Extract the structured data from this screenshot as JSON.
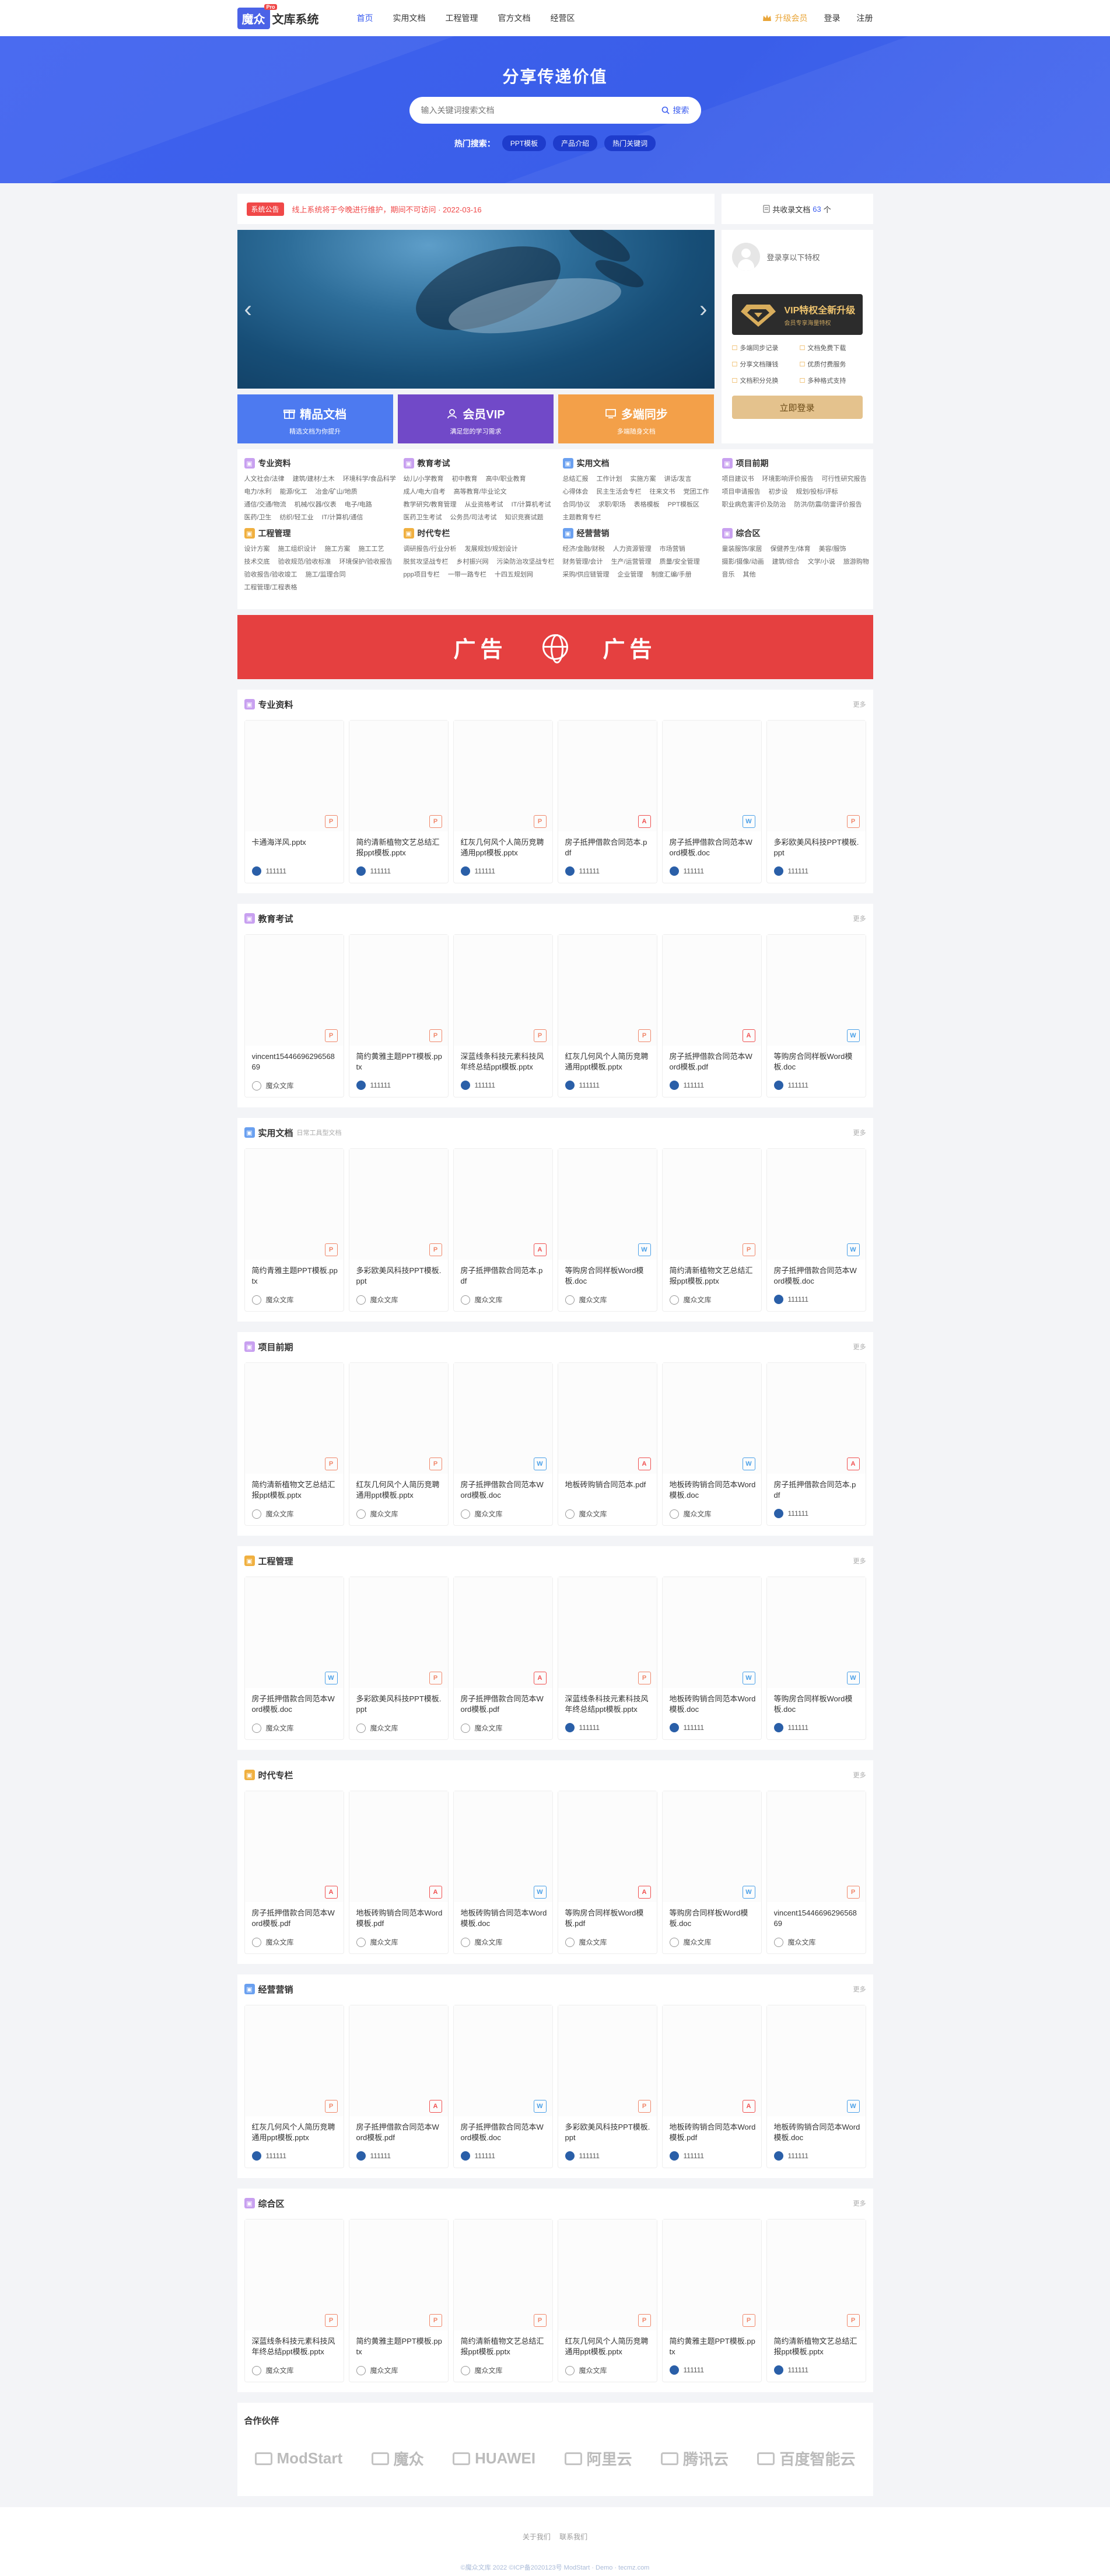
{
  "header": {
    "logo_box": "魔众",
    "logo_text": "文库系统",
    "logo_badge": "Pro",
    "nav": [
      "首页",
      "实用文档",
      "工程管理",
      "官方文档",
      "经营区"
    ],
    "vip": "升级会员",
    "login": "登录",
    "register": "注册"
  },
  "hero": {
    "title": "分享传递价值",
    "search_placeholder": "输入关键词搜索文档",
    "search_button": "搜索",
    "hot_label": "热门搜索：",
    "hot_tags": [
      "PPT模板",
      "产品介绍",
      "热门关键词"
    ]
  },
  "notice": {
    "tag": "系统公告",
    "text": "线上系统将于今晚进行维护，期间不可访问 · 2022-03-16"
  },
  "doccount": {
    "prefix": "共收录文档",
    "count": "63",
    "suffix": "个"
  },
  "banner": {
    "prev": "‹",
    "next": "›"
  },
  "features": [
    {
      "title": "精品文档",
      "sub": "精选文档为你提升"
    },
    {
      "title": "会员VIP",
      "sub": "满足您的学习需求"
    },
    {
      "title": "多端同步",
      "sub": "多端随身文档"
    }
  ],
  "user_panel": {
    "login_text": "登录享以下特权",
    "vip_title": "VIP特权全新升级",
    "vip_sub": "会员专享海量特权",
    "perks": [
      "多端同步记录",
      "文档免费下载",
      "分享文档赚钱",
      "优质付费服务",
      "文档积分兑换",
      "多种格式支持"
    ],
    "login_button": "立即登录"
  },
  "categories": [
    {
      "name": "专业资料",
      "color": "#c8a0f0",
      "items": [
        "人文社会/法律",
        "建筑/建材/土木",
        "环境科学/食品科学",
        "电力/水利",
        "能源/化工",
        "冶金/矿山/地质",
        "通信/交通/物流",
        "机械/仪器/仪表",
        "电子/电路",
        "医药/卫生",
        "纺织/轻工业",
        "IT/计算机/通信"
      ]
    },
    {
      "name": "教育考试",
      "color": "#c8a0f0",
      "items": [
        "幼儿/小学教育",
        "初中教育",
        "高中/职业教育",
        "成人/电大/自考",
        "高等教育/毕业论文",
        "教学研究/教育管理",
        "从业资格考试",
        "IT/计算机考试",
        "医药卫生考试",
        "公务员/司法考试",
        "知识竞赛试题"
      ]
    },
    {
      "name": "实用文档",
      "color": "#6aa0f0",
      "items": [
        "总结汇报",
        "工作计划",
        "实施方案",
        "讲话/发言",
        "心得体会",
        "民主生活会专栏",
        "往来文书",
        "党团工作",
        "合同/协议",
        "求职/职场",
        "表格模板",
        "PPT模板区",
        "主题教育专栏"
      ]
    },
    {
      "name": "项目前期",
      "color": "#c8a0f0",
      "items": [
        "项目建议书",
        "环境影响评价报告",
        "可行性研究报告",
        "项目申请报告",
        "初步设",
        "规划/投标/评标",
        "职业病危害评价及防治",
        "防洪/防震/防雷评价报告"
      ]
    },
    {
      "name": "工程管理",
      "color": "#f0b040",
      "items": [
        "设计方案",
        "施工组织设计",
        "施工方案",
        "施工工艺",
        "技术交底",
        "验收规范/验收标准",
        "环境保护/验收报告",
        "验收报告/验收竣工",
        "施工/监理合同",
        "工程管理/工程表格"
      ]
    },
    {
      "name": "时代专栏",
      "color": "#f0b040",
      "items": [
        "调研报告/行业分析",
        "发展规划/规划设计",
        "脱贫攻坚战专栏",
        "乡村振兴网",
        "污染防治攻坚战专栏",
        "ppp项目专栏",
        "一带一路专栏",
        "十四五规划网"
      ]
    },
    {
      "name": "经营营销",
      "color": "#6aa0f0",
      "items": [
        "经济/金融/财税",
        "人力资源管理",
        "市场营销",
        "财务管理/会计",
        "生产/运营管理",
        "质量/安全管理",
        "采购/供应链管理",
        "企业管理",
        "制度汇编/手册"
      ]
    },
    {
      "name": "综合区",
      "color": "#c8a0f0",
      "items": [
        "童装服饰/家居",
        "保健养生/体育",
        "美容/服饰",
        "摄影/摄像/动画",
        "建筑/综合",
        "文学/小说",
        "旅游购物",
        "音乐",
        "其他"
      ]
    }
  ],
  "ad": {
    "left": "广告",
    "right": "广告"
  },
  "sections": [
    {
      "title": "专业资料",
      "sub": "",
      "more": "更多",
      "color": "#c8a0f0",
      "cards": [
        {
          "name": "卡通海洋风.pptx",
          "type": "P",
          "author": "111111",
          "av": "blue"
        },
        {
          "name": "简约清新植物文艺总结汇报ppt模板.pptx",
          "type": "P",
          "author": "111111",
          "av": "blue"
        },
        {
          "name": "红灰几何风个人简历竞聘通用ppt模板.pptx",
          "type": "P",
          "author": "111111",
          "av": "blue"
        },
        {
          "name": "房子抵押借款合同范本.pdf",
          "type": "A",
          "author": "111111",
          "av": "blue"
        },
        {
          "name": "房子抵押借款合同范本Word模板.doc",
          "type": "W",
          "author": "111111",
          "av": "blue"
        },
        {
          "name": "多彩欧美风科技PPT模板.ppt",
          "type": "P",
          "author": "111111",
          "av": "blue"
        }
      ]
    },
    {
      "title": "教育考试",
      "sub": "",
      "more": "更多",
      "color": "#c8a0f0",
      "cards": [
        {
          "name": "vincent1544669629656869",
          "type": "P",
          "author": "魔众文库",
          "av": "gray"
        },
        {
          "name": "简约黄雅主题PPT模板.pptx",
          "type": "P",
          "author": "111111",
          "av": "blue"
        },
        {
          "name": "深蓝线条科技元素科技风年终总结ppt模板.pptx",
          "type": "P",
          "author": "111111",
          "av": "blue"
        },
        {
          "name": "红灰几何风个人简历竞聘通用ppt模板.pptx",
          "type": "P",
          "author": "111111",
          "av": "blue"
        },
        {
          "name": "房子抵押借款合同范本Word模板.pdf",
          "type": "A",
          "author": "111111",
          "av": "blue"
        },
        {
          "name": "等购房合同样板Word模板.doc",
          "type": "W",
          "author": "111111",
          "av": "blue"
        }
      ]
    },
    {
      "title": "实用文档",
      "sub": "日常工具型文档",
      "more": "更多",
      "color": "#6aa0f0",
      "cards": [
        {
          "name": "简约青雅主题PPT模板.pptx",
          "type": "P",
          "author": "魔众文库",
          "av": "gray"
        },
        {
          "name": "多彩欧美风科技PPT模板.ppt",
          "type": "P",
          "author": "魔众文库",
          "av": "gray"
        },
        {
          "name": "房子抵押借款合同范本.pdf",
          "type": "A",
          "author": "魔众文库",
          "av": "gray"
        },
        {
          "name": "等购房合同样板Word模板.doc",
          "type": "W",
          "author": "魔众文库",
          "av": "gray"
        },
        {
          "name": "简约清新植物文艺总结汇报ppt模板.pptx",
          "type": "P",
          "author": "魔众文库",
          "av": "gray"
        },
        {
          "name": "房子抵押借款合同范本Word模板.doc",
          "type": "W",
          "author": "111111",
          "av": "blue"
        }
      ]
    },
    {
      "title": "项目前期",
      "sub": "",
      "more": "更多",
      "color": "#c8a0f0",
      "cards": [
        {
          "name": "简约清新植物文艺总结汇报ppt模板.pptx",
          "type": "P",
          "author": "魔众文库",
          "av": "gray"
        },
        {
          "name": "红灰几何风个人简历竞聘通用ppt模板.pptx",
          "type": "P",
          "author": "魔众文库",
          "av": "gray"
        },
        {
          "name": "房子抵押借款合同范本Word模板.doc",
          "type": "W",
          "author": "魔众文库",
          "av": "gray"
        },
        {
          "name": "地板砖购销合同范本.pdf",
          "type": "A",
          "author": "魔众文库",
          "av": "gray"
        },
        {
          "name": "地板砖购销合同范本Word模板.doc",
          "type": "W",
          "author": "魔众文库",
          "av": "gray"
        },
        {
          "name": "房子抵押借款合同范本.pdf",
          "type": "A",
          "author": "111111",
          "av": "blue"
        }
      ]
    },
    {
      "title": "工程管理",
      "sub": "",
      "more": "更多",
      "color": "#f0b040",
      "cards": [
        {
          "name": "房子抵押借款合同范本Word模板.doc",
          "type": "W",
          "author": "魔众文库",
          "av": "gray"
        },
        {
          "name": "多彩欧美风科技PPT模板.ppt",
          "type": "P",
          "author": "魔众文库",
          "av": "gray"
        },
        {
          "name": "房子抵押借款合同范本Word模板.pdf",
          "type": "A",
          "author": "魔众文库",
          "av": "gray"
        },
        {
          "name": "深蓝线条科技元素科技风年终总结ppt模板.pptx",
          "type": "P",
          "author": "111111",
          "av": "blue"
        },
        {
          "name": "地板砖购销合同范本Word模板.doc",
          "type": "W",
          "author": "111111",
          "av": "blue"
        },
        {
          "name": "等购房合同样板Word模板.doc",
          "type": "W",
          "author": "111111",
          "av": "blue"
        }
      ]
    },
    {
      "title": "时代专栏",
      "sub": "",
      "more": "更多",
      "color": "#f0b040",
      "cards": [
        {
          "name": "房子抵押借款合同范本Word模板.pdf",
          "type": "A",
          "author": "魔众文库",
          "av": "gray"
        },
        {
          "name": "地板砖购销合同范本Word模板.pdf",
          "type": "A",
          "author": "魔众文库",
          "av": "gray"
        },
        {
          "name": "地板砖购销合同范本Word模板.doc",
          "type": "W",
          "author": "魔众文库",
          "av": "gray"
        },
        {
          "name": "等购房合同样板Word模板.pdf",
          "type": "A",
          "author": "魔众文库",
          "av": "gray"
        },
        {
          "name": "等购房合同样板Word模板.doc",
          "type": "W",
          "author": "魔众文库",
          "av": "gray"
        },
        {
          "name": "vincent1544669629656869",
          "type": "P",
          "author": "魔众文库",
          "av": "gray"
        }
      ]
    },
    {
      "title": "经营营销",
      "sub": "",
      "more": "更多",
      "color": "#6aa0f0",
      "cards": [
        {
          "name": "红灰几何风个人简历竞聘通用ppt模板.pptx",
          "type": "P",
          "author": "111111",
          "av": "blue"
        },
        {
          "name": "房子抵押借款合同范本Word模板.pdf",
          "type": "A",
          "author": "111111",
          "av": "blue"
        },
        {
          "name": "房子抵押借款合同范本Word模板.doc",
          "type": "W",
          "author": "111111",
          "av": "blue"
        },
        {
          "name": "多彩欧美风科技PPT模板.ppt",
          "type": "P",
          "author": "111111",
          "av": "blue"
        },
        {
          "name": "地板砖购销合同范本Word模板.pdf",
          "type": "A",
          "author": "111111",
          "av": "blue"
        },
        {
          "name": "地板砖购销合同范本Word模板.doc",
          "type": "W",
          "author": "111111",
          "av": "blue"
        }
      ]
    },
    {
      "title": "综合区",
      "sub": "",
      "more": "更多",
      "color": "#c8a0f0",
      "cards": [
        {
          "name": "深蓝线条科技元素科技风年终总结ppt模板.pptx",
          "type": "P",
          "author": "魔众文库",
          "av": "gray"
        },
        {
          "name": "简约黄雅主题PPT模板.pptx",
          "type": "P",
          "author": "魔众文库",
          "av": "gray"
        },
        {
          "name": "简约清新植物文艺总结汇报ppt模板.pptx",
          "type": "P",
          "author": "魔众文库",
          "av": "gray"
        },
        {
          "name": "红灰几何风个人简历竞聘通用ppt模板.pptx",
          "type": "P",
          "author": "魔众文库",
          "av": "gray"
        },
        {
          "name": "简约黄雅主题PPT模板.pptx",
          "type": "P",
          "author": "111111",
          "av": "blue"
        },
        {
          "name": "简约清新植物文艺总结汇报ppt模板.pptx",
          "type": "P",
          "author": "111111",
          "av": "blue"
        }
      ]
    }
  ],
  "partners": {
    "title": "合作伙伴",
    "logos": [
      "ModStart",
      "魔众",
      "HUAWEI",
      "阿里云",
      "腾讯云",
      "百度智能云"
    ]
  },
  "footer": {
    "links": [
      "关于我们",
      "联系我们"
    ],
    "copy": "©魔众文库 2022 ©ICP备2020123号 ModStart · Demo · tecmz.com"
  }
}
